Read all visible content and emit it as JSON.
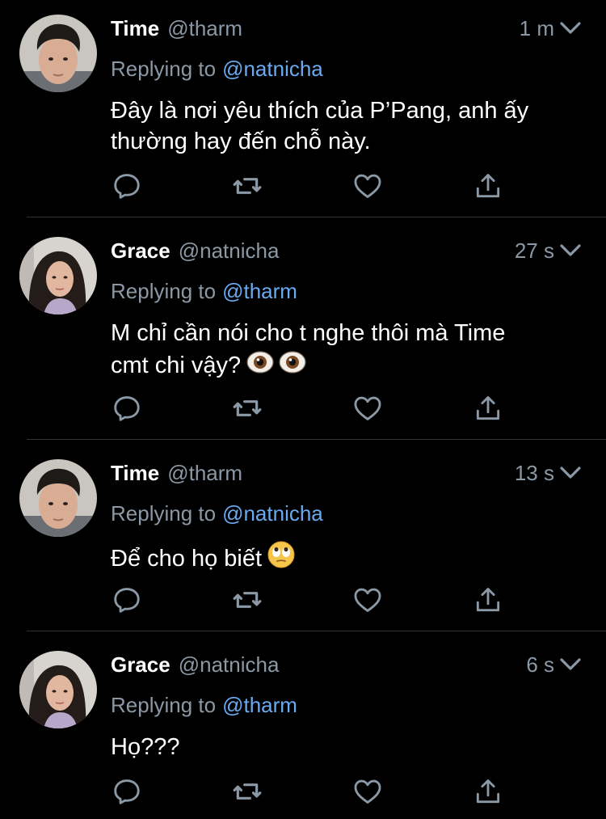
{
  "tweets": [
    {
      "name": "Time",
      "handle": "@tharm",
      "time": "1 m",
      "replying_label": "Replying to",
      "replying_to": "@natnicha",
      "text": "Đây là nơi yêu thích của P’Pang, anh ấy\nthường hay đến chỗ này."
    },
    {
      "name": "Grace",
      "handle": "@natnicha",
      "time": "27 s",
      "replying_label": "Replying to",
      "replying_to": "@tharm",
      "text": "M chỉ cần nói cho t nghe thôi mà Time\ncmt chi vậy?"
    },
    {
      "name": "Time",
      "handle": "@tharm",
      "time": "13 s",
      "replying_label": "Replying to",
      "replying_to": "@natnicha",
      "text": "Để cho họ biết"
    },
    {
      "name": "Grace",
      "handle": "@natnicha",
      "time": "6 s",
      "replying_label": "Replying to",
      "replying_to": "@tharm",
      "text": "Họ???"
    }
  ],
  "icons": {
    "chevron": "chevron-down-icon",
    "reply": "reply-icon",
    "retweet": "retweet-icon",
    "like": "heart-icon",
    "share": "share-icon",
    "emoji_eyes": "eyes-emoji",
    "emoji_eyeroll": "eye-roll-emoji"
  },
  "colors": {
    "background": "#000000",
    "text": "#ffffff",
    "muted": "#8b98a5",
    "link": "#6aaaf0",
    "divider": "#2f3336"
  }
}
